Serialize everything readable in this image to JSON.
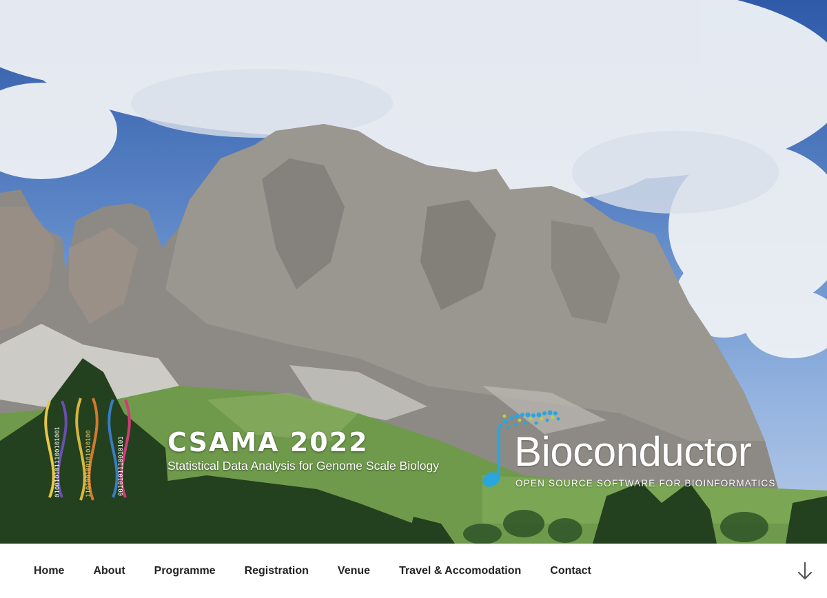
{
  "header": {
    "site_title": "CSAMA 2022",
    "tagline": "Statistical Data Analysis for Genome Scale Biology"
  },
  "csama_logo": {
    "strand_1": "0100101011100101001",
    "strand_2": "110100100101010100",
    "strand_3": "0010101110010101"
  },
  "bioconductor_logo": {
    "name": "Bioconductor",
    "subtitle": "OPEN SOURCE SOFTWARE FOR BIOINFORMATICS"
  },
  "nav": {
    "items": [
      {
        "label": "Home"
      },
      {
        "label": "About"
      },
      {
        "label": "Programme"
      },
      {
        "label": "Registration"
      },
      {
        "label": "Venue"
      },
      {
        "label": "Travel & Accomodation"
      },
      {
        "label": "Contact"
      }
    ],
    "scroll_icon": "arrow-down-icon"
  },
  "colors": {
    "nav_text": "#222222",
    "sky": "#3d68b3",
    "bioconductor_blue": "#1a9ad6"
  }
}
